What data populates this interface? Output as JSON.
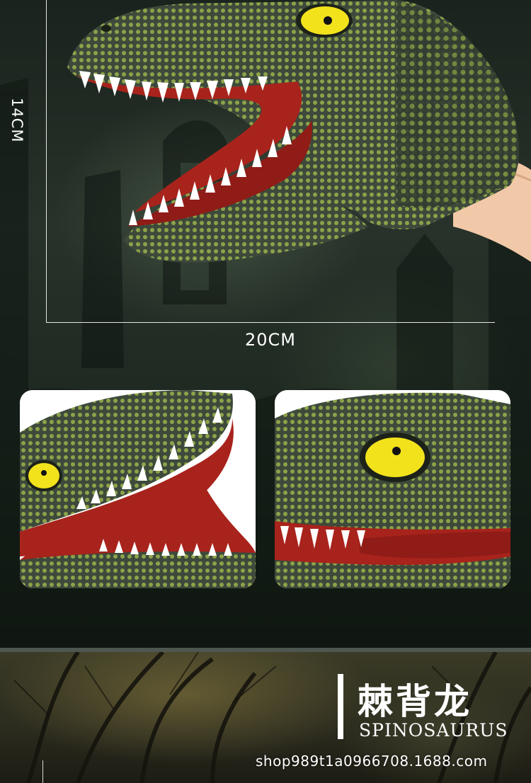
{
  "dimensions": {
    "height_label": "14CM",
    "width_label": "20CM"
  },
  "product": {
    "name_cn": "棘背龙",
    "name_en": "SPINOSAURUS"
  },
  "shop": {
    "url": "shop989t1a0966708.1688.com"
  },
  "colors": {
    "skin_dark": "#3c4a3c",
    "skin_scale": "#9aab4a",
    "eye": "#f2e21c",
    "mouth": "#a8231c",
    "teeth": "#ffffff"
  }
}
